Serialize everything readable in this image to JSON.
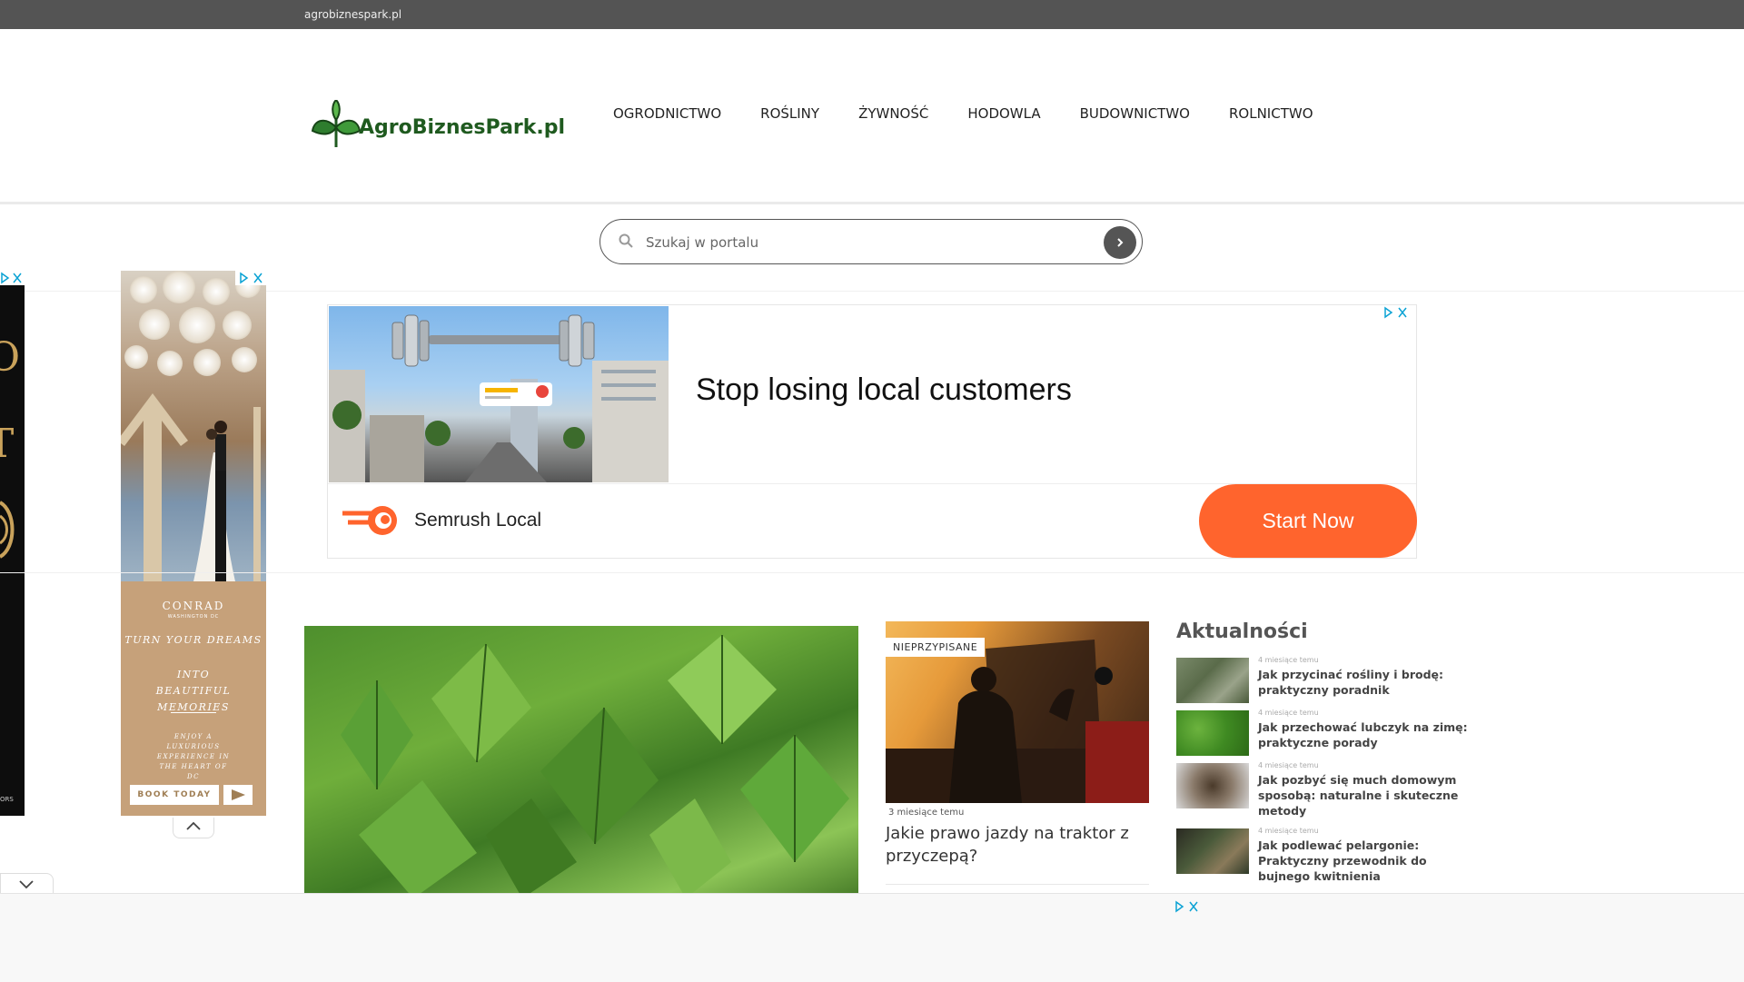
{
  "site": {
    "domain": "agrobiznespark.pl",
    "logo_text": "AgroBiznesPark.pl"
  },
  "nav": {
    "items": [
      "OGRODNICTWO",
      "ROŚLINY",
      "ŻYWNOŚĆ",
      "HODOWLA",
      "BUDOWNICTWO",
      "ROLNICTWO"
    ]
  },
  "search": {
    "placeholder": "Szukaj w portalu",
    "value": ""
  },
  "ads": {
    "tower": {
      "brand": "CONRAD",
      "brand_sub": "WASHINGTON DC",
      "line1": "TURN YOUR DREAMS",
      "line2": "INTO BEAUTIFUL MEMORIES",
      "line3": "ENJOY A LUXURIOUS EXPERIENCE IN THE HEART OF DC",
      "cta": "BOOK TODAY"
    },
    "left_strip": {
      "footer_text": "ORS"
    },
    "banner": {
      "headline": "Stop losing local customers",
      "brand": "Semrush Local",
      "cta": "Start Now",
      "brand_color": "#ff642d"
    }
  },
  "featured": {
    "category_badge": "NIEPRZYPISANE",
    "date": "3 miesiące temu",
    "title": "Jakie prawo jazdy na traktor z przyczepą?"
  },
  "news": {
    "heading": "Aktualności",
    "items": [
      {
        "date": "4 miesiące temu",
        "title": "Jak przycinać rośliny i brodę: praktyczny poradnik"
      },
      {
        "date": "4 miesiące temu",
        "title": "Jak przechować lubczyk na zimę: praktyczne porady"
      },
      {
        "date": "4 miesiące temu",
        "title": "Jak pozbyć się much domowym sposobą: naturalne i skuteczne metody"
      },
      {
        "date": "4 miesiące temu",
        "title": "Jak podlewać pelargonie: Praktyczny przewodnik do bujnego kwitnienia"
      }
    ]
  },
  "colors": {
    "topbar": "#545454",
    "logo_green": "#1f5a1f",
    "adchoices": "#0aa2d4"
  }
}
